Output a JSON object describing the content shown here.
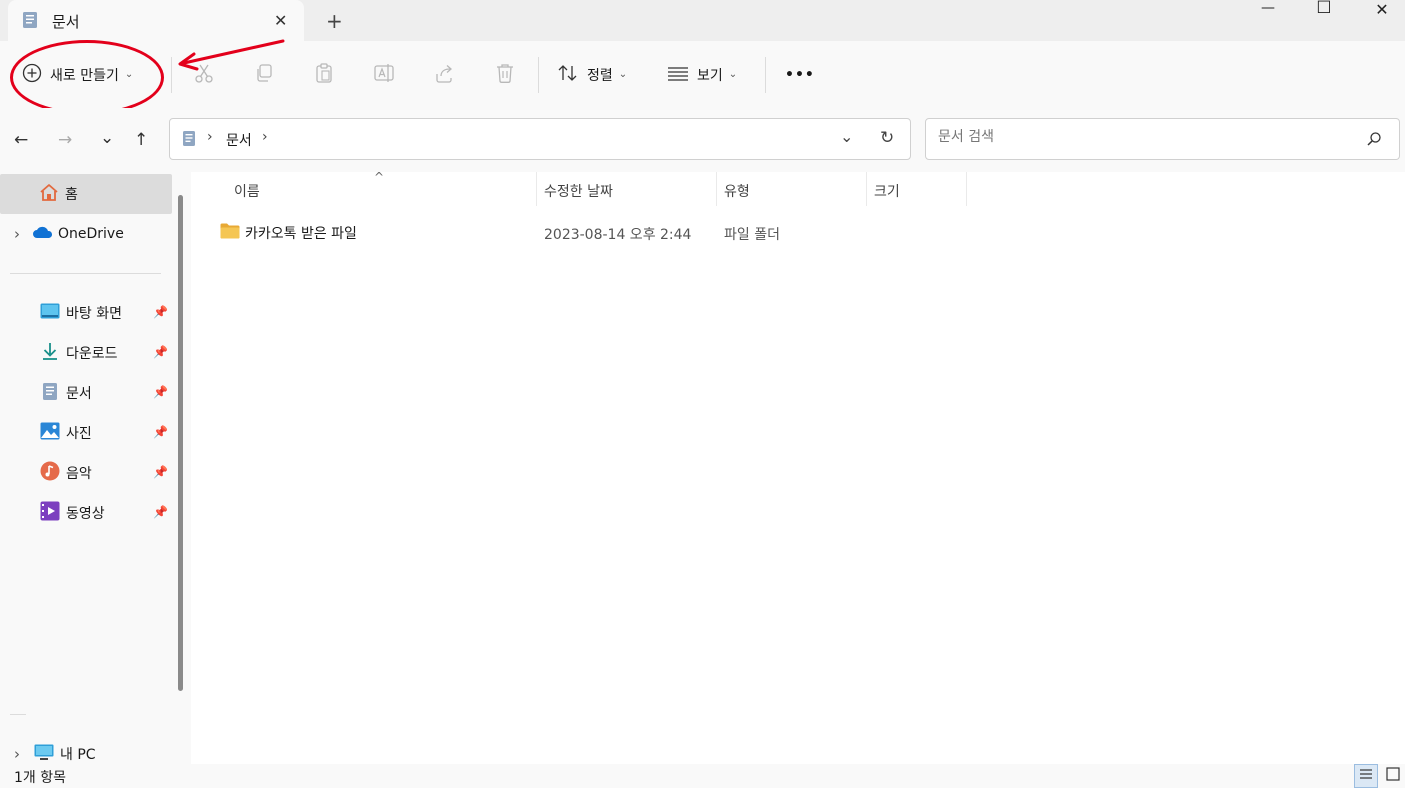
{
  "window": {
    "tab_title": "문서",
    "tab_close": "✕",
    "new_tab": "+",
    "minimize": "—",
    "maximize": "☐",
    "close": "✕"
  },
  "toolbar": {
    "new_label": "새로 만들기",
    "sort_label": "정렬",
    "view_label": "보기",
    "more": "•••"
  },
  "nav": {
    "back": "←",
    "forward": "→",
    "recent": "⌄",
    "up": "↑"
  },
  "address": {
    "segments": [
      "문서"
    ],
    "sep": "›",
    "refresh": "↻",
    "dropdown": "⌄"
  },
  "search": {
    "placeholder": "문서 검색"
  },
  "sidebar": {
    "home": "홈",
    "onedrive": "OneDrive",
    "quick": [
      {
        "label": "바탕 화면",
        "icon": "desktop-icon"
      },
      {
        "label": "다운로드",
        "icon": "download-icon"
      },
      {
        "label": "문서",
        "icon": "documents-icon"
      },
      {
        "label": "사진",
        "icon": "pictures-icon"
      },
      {
        "label": "음악",
        "icon": "music-icon"
      },
      {
        "label": "동영상",
        "icon": "videos-icon"
      }
    ],
    "this_pc": "내 PC",
    "expand": "›"
  },
  "columns": {
    "name": "이름",
    "modified": "수정한 날짜",
    "type": "유형",
    "size": "크기",
    "sort_indicator": "^"
  },
  "files": [
    {
      "name": "카카오톡 받은 파일",
      "modified": "2023-08-14 오후 2:44",
      "type": "파일 폴더",
      "size": ""
    }
  ],
  "status": {
    "count": "1개 항목"
  },
  "colors": {
    "accent": "#0067c0",
    "annotation": "#e3001b",
    "folder": "#f0c04a"
  }
}
